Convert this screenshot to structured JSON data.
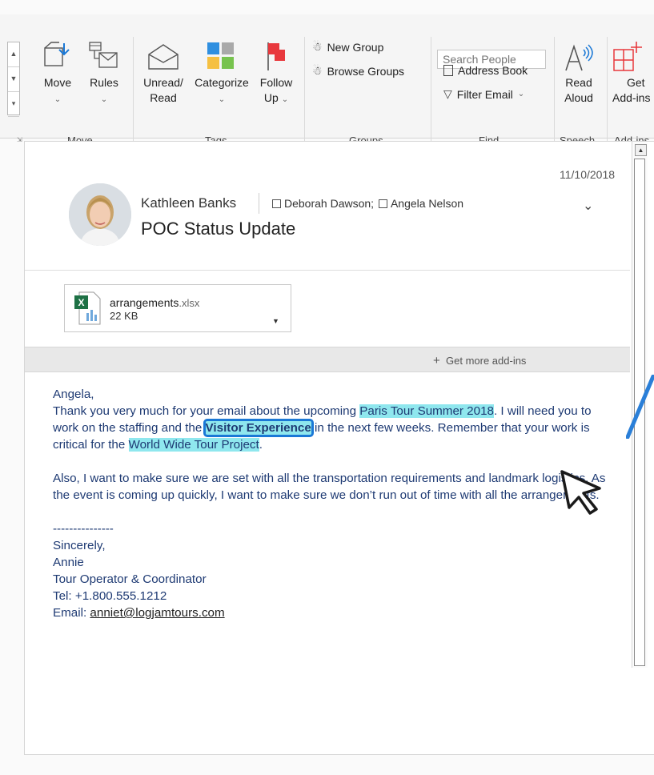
{
  "ribbon": {
    "groups": {
      "move": "Move",
      "tags": "Tags",
      "groups": "Groups",
      "find": "Find",
      "speech": "Speech",
      "addins": "Add-ins"
    },
    "buttons": {
      "move": "Move",
      "rules": "Rules",
      "unread_read_1": "Unread/",
      "unread_read_2": "Read",
      "categorize": "Categorize",
      "follow_up_1": "Follow",
      "follow_up_2": "Up",
      "new_group": "New Group",
      "browse_groups": "Browse Groups",
      "address_book": "Address Book",
      "filter_email": "Filter Email",
      "read_aloud_1": "Read",
      "read_aloud_2": "Aloud",
      "get_addins_1": "Get",
      "get_addins_2": "Add-ins"
    },
    "search": {
      "placeholder": "Search People"
    }
  },
  "message": {
    "date": "11/10/2018",
    "sender": "Kathleen Banks",
    "recipients": [
      "Deborah Dawson;",
      "Angela Nelson"
    ],
    "subject": "POC Status Update",
    "attachment": {
      "name": "arrangements",
      "ext": ".xlsx",
      "size": "22 KB"
    },
    "get_more_addins": "Get more add-ins",
    "body": {
      "greeting": "Angela,",
      "p1_a": "Thank you very much for your email about the upcoming ",
      "p1_hl1": "Paris Tour Summer 2018",
      "p1_b": ". I will need you to work on the staffing and the ",
      "p1_hl2": "Visitor Experience",
      "p1_c": " in the next few weeks. Remember that your work is critical for the ",
      "p1_hl3": "World Wide Tour Project",
      "p1_d": ".",
      "p2": "Also, I want to make sure we are set with all the transportation requirements and landmark logistics.  As the event is coming up quickly,  I want to make sure we don’t run out of time with all the arrangements.",
      "rule": "---------------",
      "closing": "Sincerely,",
      "name": "Annie",
      "title": "Tour Operator & Coordinator",
      "tel": "Tel: +1.800.555.1212",
      "email_label": "Email: ",
      "email": "anniet@logjamtours.com"
    }
  },
  "colors": {
    "highlight": "#8fe7ee",
    "accent": "#1a78d6",
    "body_text": "#1e3a73"
  }
}
